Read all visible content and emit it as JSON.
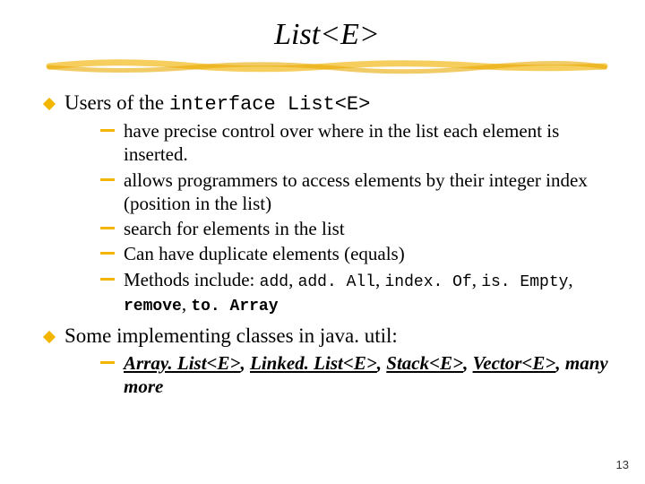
{
  "title": "List<E>",
  "bullet1": {
    "prefix": "Users of the ",
    "code": "interface List<E>",
    "subs": [
      "have precise control over where in the list each element is inserted.",
      "allows programmers to access elements by their integer index (position in the list)",
      "search for elements in the list",
      "Can have duplicate elements (equals)"
    ],
    "methods_prefix": "Methods include: ",
    "methods": [
      "add",
      "add. All",
      "index. Of",
      "is. Empty",
      "remove",
      "to. Array"
    ]
  },
  "bullet2": {
    "text": "Some implementing classes in java. util:",
    "impl_classes": [
      "Array. List<E>",
      "Linked. List<E>",
      "Stack<E>",
      "Vector<E>"
    ],
    "impl_suffix": ", many more"
  },
  "page_number": "13"
}
